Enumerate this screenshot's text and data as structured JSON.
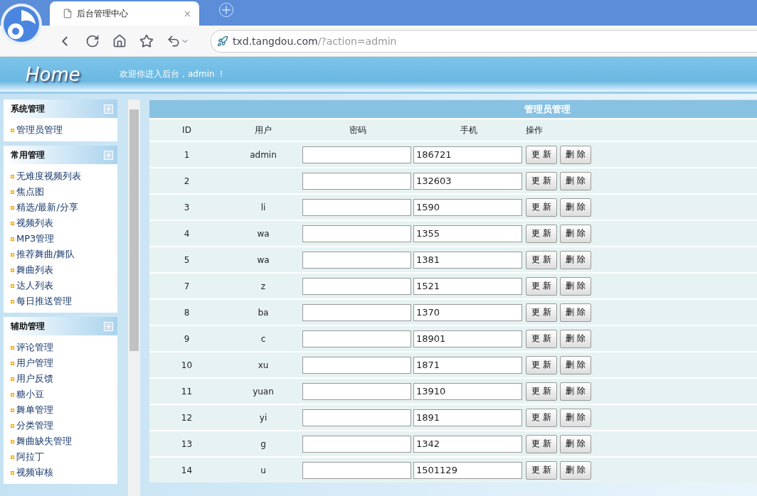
{
  "browser": {
    "tab_title": "后台管理中心",
    "url_host": "txd.tangdou.com",
    "url_path": "/?action=admin"
  },
  "header": {
    "logo": "Home",
    "welcome": "欢迎你进入后台，admin ！"
  },
  "sidebar": {
    "sections": [
      {
        "title": "系统管理",
        "items": [
          "管理员管理"
        ]
      },
      {
        "title": "常用管理",
        "items": [
          "无难度视频列表",
          "焦点图",
          "精选/最新/分享",
          "视频列表",
          "MP3管理",
          "推荐舞曲/舞队",
          "舞曲列表",
          "达人列表",
          "每日推送管理"
        ]
      },
      {
        "title": "辅助管理",
        "items": [
          "评论管理",
          "用户管理",
          "用户反馈",
          "糖小豆",
          "舞单管理",
          "分类管理",
          "舞曲缺失管理",
          "阿拉丁",
          "视频审核"
        ]
      }
    ]
  },
  "table": {
    "title": "管理员管理",
    "columns": [
      "ID",
      "用户",
      "密码",
      "手机",
      "操作"
    ],
    "rows": [
      {
        "id": "1",
        "user": "admin",
        "phone": "186721",
        "update": "更 新",
        "delete": "删 除"
      },
      {
        "id": "2",
        "phone": "132603",
        "update": "更 新",
        "delete": "删 除"
      },
      {
        "id": "3",
        "user": "li",
        "phone": "1590",
        "update": "更 新",
        "delete": "删 除"
      },
      {
        "id": "4",
        "user": "wa",
        "phone": "1355",
        "update": "更 新",
        "delete": "删 除"
      },
      {
        "id": "5",
        "user": "wa",
        "phone": "1381",
        "update": "更 新",
        "delete": "删 除"
      },
      {
        "id": "7",
        "user": "z",
        "phone": "1521",
        "update": "更 新",
        "delete": "删 除"
      },
      {
        "id": "8",
        "user": "ba",
        "phone": "1370",
        "update": "更 新",
        "delete": "删 除"
      },
      {
        "id": "9",
        "user": "c",
        "phone": "18901",
        "update": "更 新",
        "delete": "删 除"
      },
      {
        "id": "10",
        "user": "xu",
        "phone": "1871",
        "update": "更 新",
        "delete": "删 除"
      },
      {
        "id": "11",
        "user": "yuan",
        "phone": "13910",
        "update": "更 新",
        "delete": "删 除"
      },
      {
        "id": "12",
        "user": "yi",
        "phone": "1891",
        "update": "更 新",
        "delete": "删 除"
      },
      {
        "id": "13",
        "user": "g",
        "phone": "1342",
        "update": "更 新",
        "delete": "删 除"
      },
      {
        "id": "14",
        "user": "u",
        "phone": "1501129",
        "update": "更 新",
        "delete": "删 除"
      }
    ]
  }
}
